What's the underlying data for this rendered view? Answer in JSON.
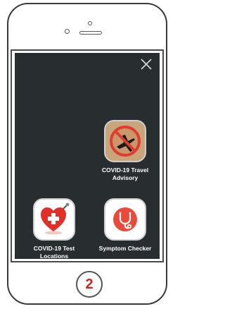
{
  "apps": [
    {
      "label": "COVID-19 Travel Advisory",
      "icon": "no-flight-icon"
    },
    {
      "label": "COVID-19 Test Locations",
      "icon": "heart-plus-icon"
    },
    {
      "label": "Symptom Checker",
      "icon": "stethoscope-icon"
    }
  ],
  "close_icon": "close-icon",
  "home_button": {
    "label": "2"
  },
  "colors": {
    "screen_bg": "#282d30",
    "label_text": "#ffffff",
    "accent_red": "#e03c31",
    "home_number": "#d0231f"
  }
}
